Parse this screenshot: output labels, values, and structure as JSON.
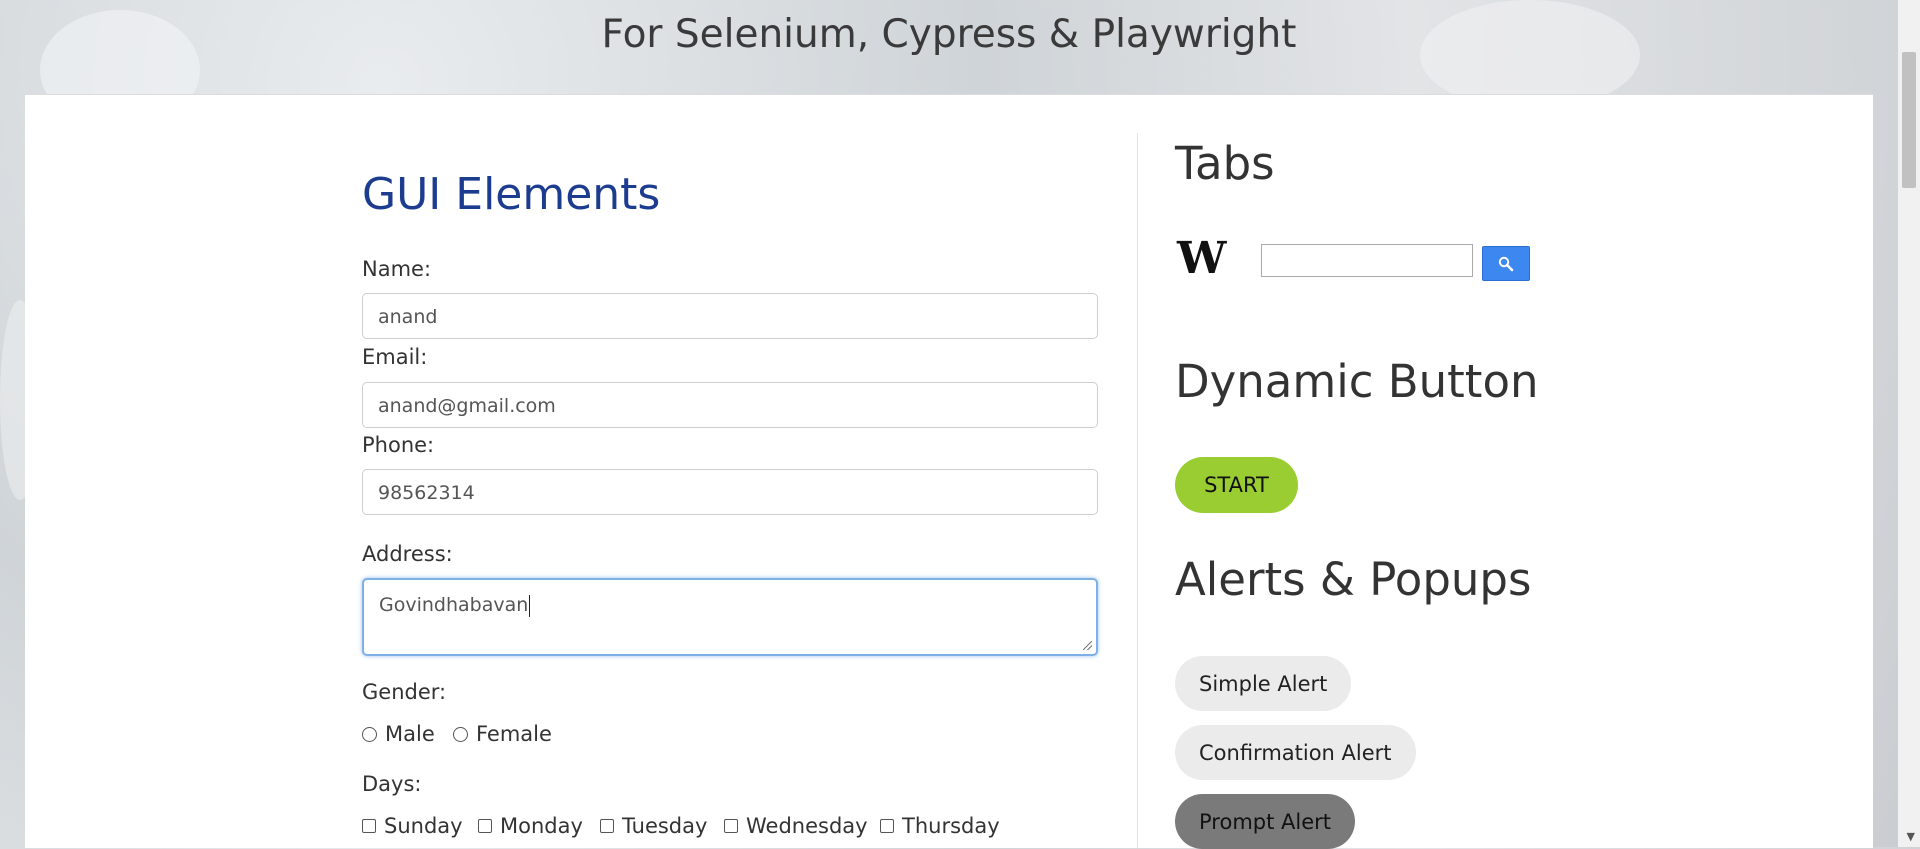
{
  "banner": {
    "subtitle": "For Selenium, Cypress & Playwright"
  },
  "gui": {
    "title": "GUI Elements",
    "name": {
      "label": "Name:",
      "value": "anand"
    },
    "email": {
      "label": "Email:",
      "value": "anand@gmail.com"
    },
    "phone": {
      "label": "Phone:",
      "value": "98562314"
    },
    "address": {
      "label": "Address:",
      "value": "Govindhabavan"
    },
    "gender": {
      "label": "Gender:",
      "options": [
        "Male",
        "Female"
      ]
    },
    "days": {
      "label": "Days:",
      "options": [
        "Sunday",
        "Monday",
        "Tuesday",
        "Wednesday",
        "Thursday"
      ]
    }
  },
  "tabs": {
    "title": "Tabs",
    "logo": "W"
  },
  "dynamic": {
    "title": "Dynamic Button",
    "start_label": "START",
    "start_color": "#9acd32"
  },
  "alerts": {
    "title": "Alerts & Popups",
    "simple": "Simple Alert",
    "confirm": "Confirmation Alert",
    "prompt": "Prompt Alert"
  }
}
